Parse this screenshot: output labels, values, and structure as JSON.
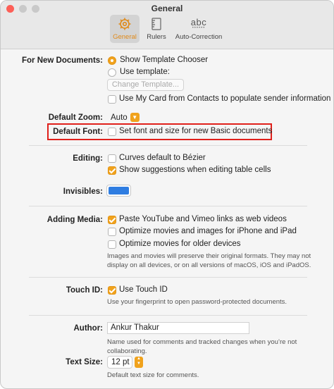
{
  "window": {
    "title": "General"
  },
  "tabs": [
    {
      "label": "General",
      "icon": "gear-icon",
      "active": true
    },
    {
      "label": "Rulers",
      "icon": "ruler-icon",
      "active": false
    },
    {
      "label": "Auto-Correction",
      "icon_text": "abc",
      "active": false
    }
  ],
  "new_documents": {
    "label": "For New Documents:",
    "show_chooser": "Show Template Chooser",
    "use_template": "Use template:",
    "change_template": "Change Template...",
    "use_my_card": "Use My Card from Contacts to populate sender information"
  },
  "zoom": {
    "label": "Default Zoom:",
    "value": "Auto"
  },
  "font": {
    "label": "Default Font:",
    "text": "Set font and size for new Basic documents"
  },
  "editing": {
    "label": "Editing:",
    "curves": "Curves default to Bézier",
    "suggestions": "Show suggestions when editing table cells"
  },
  "invisibles": {
    "label": "Invisibles:",
    "color": "#2f7de1"
  },
  "media": {
    "label": "Adding Media:",
    "paste_links": "Paste YouTube and Vimeo links as web videos",
    "optimize_iphone": "Optimize movies and images for iPhone and iPad",
    "optimize_older": "Optimize movies for older devices",
    "help_line1": "Images and movies will preserve their original formats. They may not",
    "help_line2": "display on all devices, or on all versions of macOS, iOS and iPadOS."
  },
  "touch_id": {
    "label": "Touch ID:",
    "use": "Use Touch ID",
    "help": "Use your fingerprint to open password-protected documents."
  },
  "author": {
    "label": "Author:",
    "value": "Ankur Thakur",
    "help_line1": "Name used for comments and tracked changes when you’re not",
    "help_line2": "collaborating."
  },
  "text_size": {
    "label": "Text Size:",
    "value": "12 pt",
    "help": "Default text size for comments."
  },
  "colors": {
    "accent": "#f0a21c",
    "highlight": "#e0201b"
  }
}
